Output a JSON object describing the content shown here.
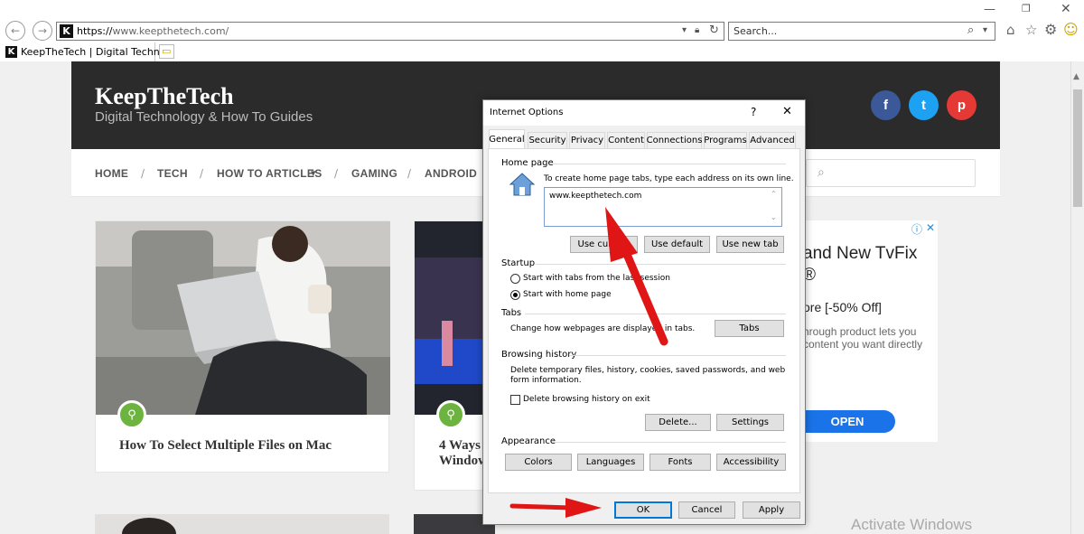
{
  "browser": {
    "url": "https://www.keepthetech.com/",
    "url_scheme": "https://",
    "url_rest": "www.keepthetech.com/",
    "search_placeholder": "Search...",
    "tab_title": "KeepTheTech | Digital Techn..."
  },
  "site": {
    "title": "KeepTheTech",
    "tagline": "Digital Technology & How To Guides",
    "menu": [
      "HOME",
      "TECH",
      "HOW TO ARTICLES",
      "GAMING",
      "ANDROID"
    ],
    "social": [
      {
        "label": "f",
        "color": "#3b5998"
      },
      {
        "label": "t",
        "color": "#1da1f2"
      },
      {
        "label": "p",
        "color": "#e53935"
      }
    ],
    "articles": [
      {
        "title": "How To Select Multiple Files on Mac"
      },
      {
        "title_line1": "4 Ways",
        "title_line2": "Window"
      }
    ],
    "ad": {
      "headline_line1": "and New TvFix",
      "headline_line2": "®",
      "offer": "ore [-50% Off]",
      "body_line1": "hrough product lets you",
      "body_line2": "content you want directly",
      "cta": "OPEN"
    },
    "watermark": "Activate Windows"
  },
  "dialog": {
    "title": "Internet Options",
    "help": "?",
    "close": "✕",
    "tabs": [
      "General",
      "Security",
      "Privacy",
      "Content",
      "Connections",
      "Programs",
      "Advanced"
    ],
    "homepage": {
      "group": "Home page",
      "description": "To create home page tabs, type each address on its own line.",
      "value": "www.keepthetech.com",
      "buttons": [
        "Use current",
        "Use default",
        "Use new tab"
      ]
    },
    "startup": {
      "group": "Startup",
      "option1": "Start with tabs from the last session",
      "option2": "Start with home page"
    },
    "tabs_group": {
      "group": "Tabs",
      "description": "Change how webpages are displayed in tabs.",
      "button": "Tabs"
    },
    "history": {
      "group": "Browsing history",
      "description_line1": "Delete temporary files, history, cookies, saved passwords, and web",
      "description_line2": "form information.",
      "checkbox": "Delete browsing history on exit",
      "buttons": [
        "Delete...",
        "Settings"
      ]
    },
    "appearance": {
      "group": "Appearance",
      "buttons": [
        "Colors",
        "Languages",
        "Fonts",
        "Accessibility"
      ]
    },
    "footer": [
      "OK",
      "Cancel",
      "Apply"
    ]
  }
}
